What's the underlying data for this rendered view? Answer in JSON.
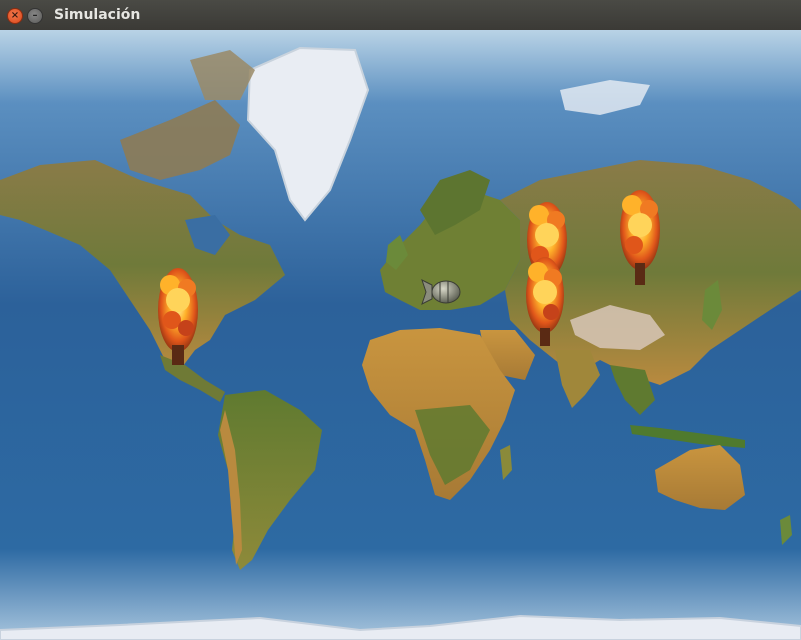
{
  "window": {
    "title": "Simulación",
    "close_icon": "close-icon",
    "minimize_icon": "minimize-icon"
  },
  "map": {
    "name": "world-map",
    "ocean_color": "#2a5f97",
    "land_color": "#b7883e",
    "ice_color": "#e8eef4"
  },
  "sprites": {
    "explosions": [
      {
        "id": "north-america"
      },
      {
        "id": "central-asia-upper"
      },
      {
        "id": "central-asia-lower"
      },
      {
        "id": "siberia"
      }
    ],
    "missile": {
      "id": "mediterranean",
      "icon": "missile-icon"
    }
  }
}
